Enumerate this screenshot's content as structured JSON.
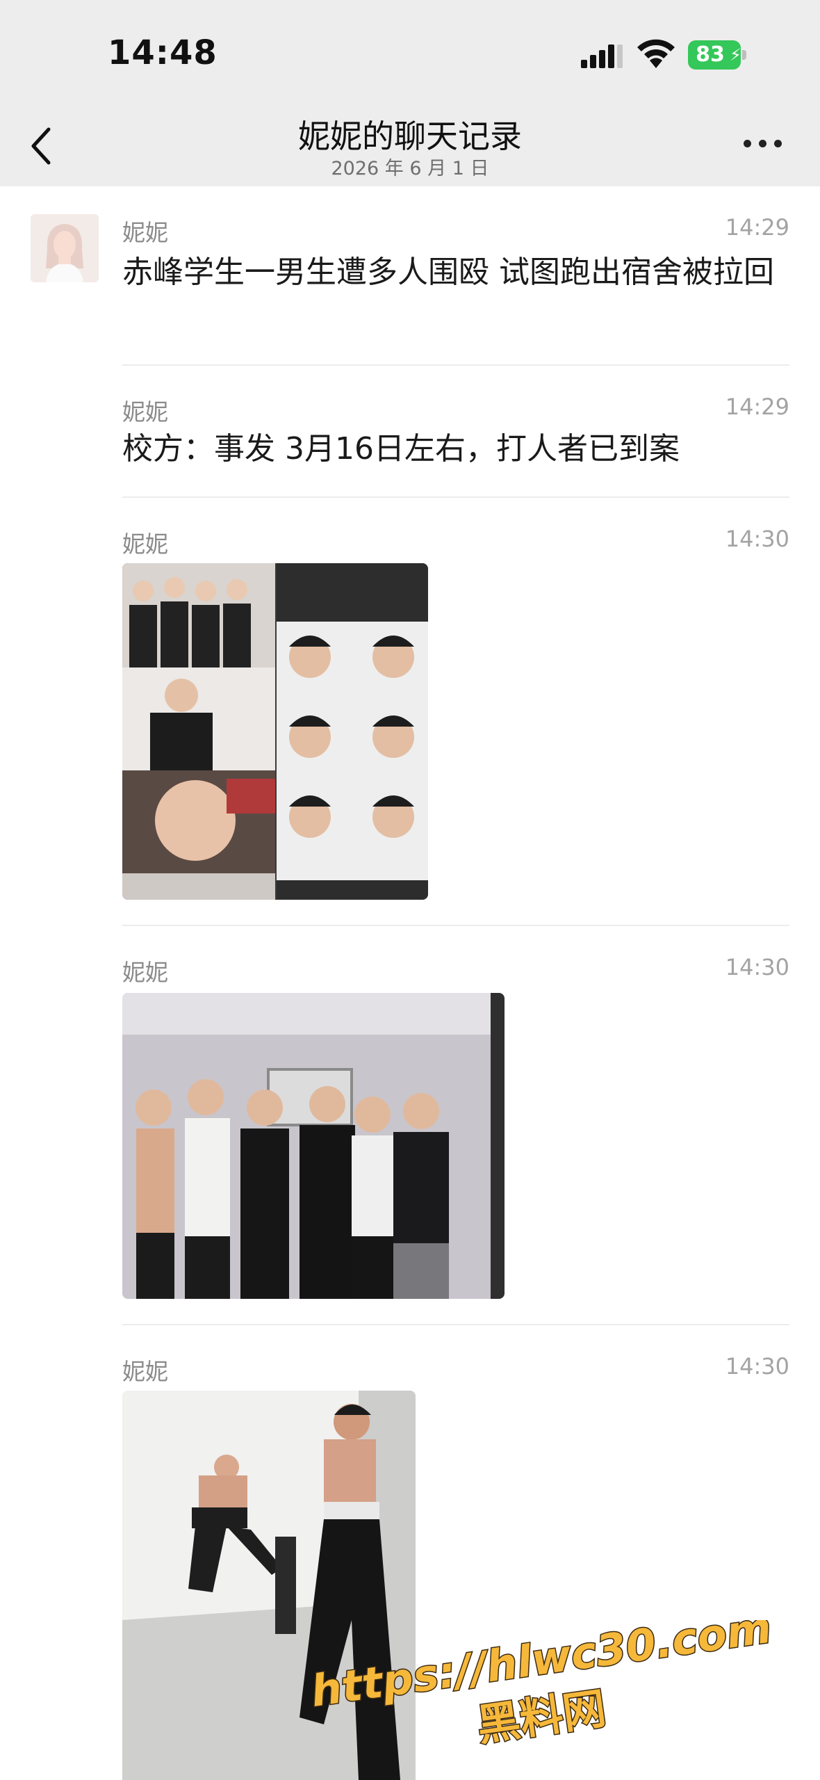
{
  "status_bar": {
    "time": "14:48",
    "battery_level": "83",
    "icons": [
      "signal-icon",
      "wifi-icon",
      "battery-icon",
      "charging-bolt-icon"
    ]
  },
  "nav": {
    "title": "妮妮的聊天记录",
    "subtitle": "2026 年 6 月 1 日",
    "icons": [
      "back-icon",
      "more-icon"
    ]
  },
  "messages": [
    {
      "sender": "妮妮",
      "time": "14:29",
      "type": "text",
      "text": "赤峰学生一男生遭多人围殴 试图跑出宿舍被拉回"
    },
    {
      "sender": "妮妮",
      "time": "14:29",
      "type": "text",
      "text": "校方：事发 3月16日左右，打人者已到案"
    },
    {
      "sender": "妮妮",
      "time": "14:30",
      "type": "image",
      "image": "collage of student selfie screenshots"
    },
    {
      "sender": "妮妮",
      "time": "14:30",
      "type": "image",
      "image": "group photo of students in dormitory"
    },
    {
      "sender": "妮妮",
      "time": "14:30",
      "type": "image",
      "image": "student kicking another student in dorm room"
    }
  ],
  "watermark": {
    "url": "https://hlwc30.com",
    "label": "黑料网"
  }
}
